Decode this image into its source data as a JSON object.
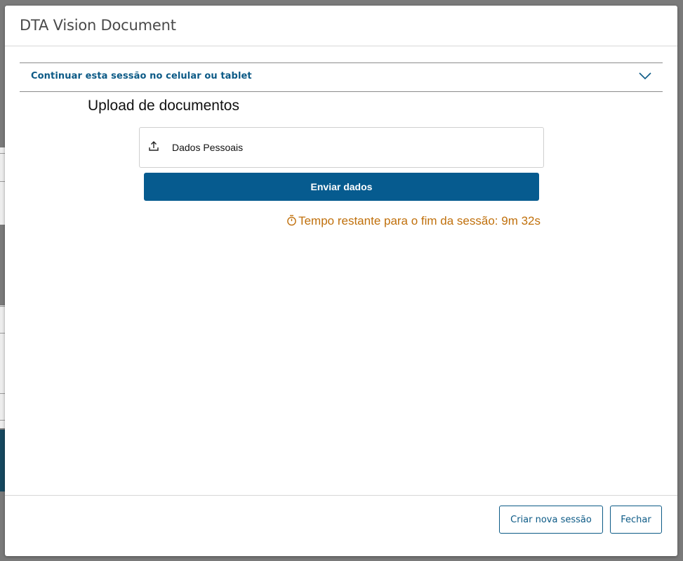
{
  "modal": {
    "title": "DTA Vision Document"
  },
  "accordion": {
    "label": "Continuar esta sessão no celular ou tablet",
    "icon": "chevron-down-icon"
  },
  "upload": {
    "section_title": "Upload de documentos",
    "items": [
      {
        "label": "Dados Pessoais",
        "icon": "upload-icon"
      }
    ],
    "send_label": "Enviar dados"
  },
  "timer": {
    "icon": "stopwatch-icon",
    "text": "Tempo restante para o fim da sessão: 9m 32s"
  },
  "footer": {
    "new_session_label": "Criar nova sessão",
    "close_label": "Fechar"
  },
  "colors": {
    "accent": "#0c5a86",
    "primary_button": "#065b8f",
    "timer": "#c0700c",
    "overlay": "#7a7a7a"
  }
}
